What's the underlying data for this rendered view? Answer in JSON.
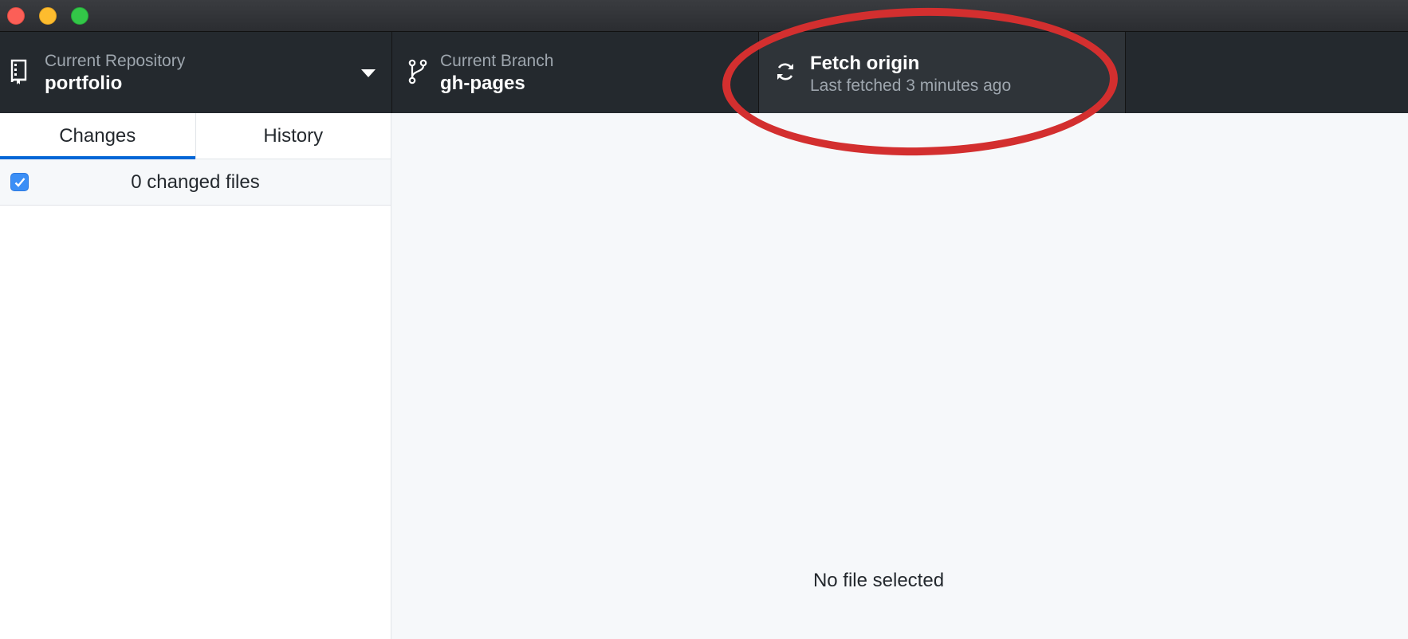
{
  "toolbar": {
    "repository": {
      "caption": "Current Repository",
      "value": "portfolio"
    },
    "branch": {
      "caption": "Current Branch",
      "value": "gh-pages"
    },
    "fetch": {
      "title": "Fetch origin",
      "subtitle": "Last fetched 3 minutes ago"
    }
  },
  "sidebar": {
    "tabs": [
      {
        "label": "Changes",
        "active": true
      },
      {
        "label": "History",
        "active": false
      }
    ],
    "changed_files_label": "0 changed files",
    "select_all_checked": true
  },
  "main": {
    "empty_message": "No file selected"
  },
  "icons": {
    "repository": "repo-icon",
    "branch": "git-branch-icon",
    "fetch": "sync-icon",
    "dropdown": "caret-down-icon"
  },
  "colors": {
    "toolbar_bg": "#24292e",
    "accent": "#0366d6",
    "annotation": "#d32f2f",
    "checkbox": "#3b8ff6"
  }
}
